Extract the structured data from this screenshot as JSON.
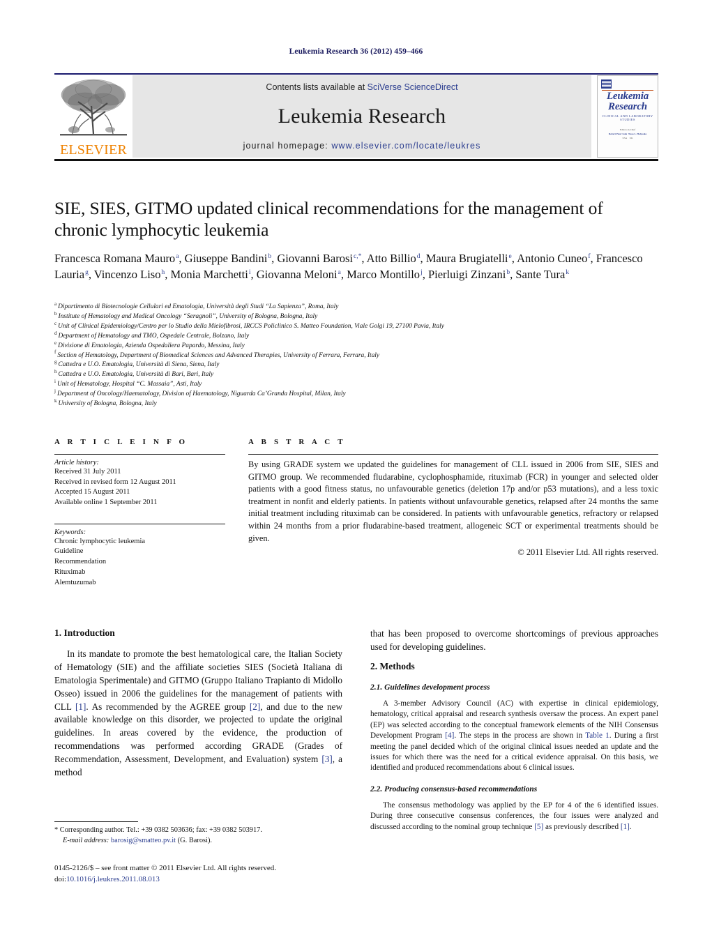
{
  "running_head": "Leukemia Research 36 (2012) 459–466",
  "masthead": {
    "contents_prefix": "Contents lists available at ",
    "contents_link": "SciVerse ScienceDirect",
    "journal_title": "Leukemia Research",
    "homepage_prefix": "journal homepage: ",
    "homepage_url": "www.elsevier.com/locate/leukres",
    "publisher_wordmark": "ELSEVIER",
    "cover": {
      "title_line1": "Leukemia",
      "title_line2": "Research",
      "subtitle": "Clinical and Laboratory Studies",
      "meta_label": "Editors-in-Chief",
      "meta_a": "Robert Peter Gale",
      "meta_b": "Tessa L. Holyoake",
      "meta_a_sub": "USA",
      "meta_b_sub": "UK"
    }
  },
  "article": {
    "title": "SIE, SIES, GITMO updated clinical recommendations for the management of chronic lymphocytic leukemia",
    "authors": [
      {
        "name": "Francesca Romana Mauro",
        "sup": "a",
        "sep": ","
      },
      {
        "name": "Giuseppe Bandini",
        "sup": "b",
        "sep": ","
      },
      {
        "name": "Giovanni Barosi",
        "sup": "c,*",
        "sep": ","
      },
      {
        "name": "Atto Billio",
        "sup": "d",
        "sep": ","
      },
      {
        "name": "Maura Brugiatelli",
        "sup": "e",
        "sep": ","
      },
      {
        "name": "Antonio Cuneo",
        "sup": "f",
        "sep": ","
      },
      {
        "name": "Francesco Lauria",
        "sup": "g",
        "sep": ","
      },
      {
        "name": "Vincenzo Liso",
        "sup": "h",
        "sep": ","
      },
      {
        "name": "Monia Marchetti",
        "sup": "i",
        "sep": ","
      },
      {
        "name": "Giovanna Meloni",
        "sup": "a",
        "sep": ","
      },
      {
        "name": "Marco Montillo",
        "sup": "j",
        "sep": ","
      },
      {
        "name": "Pierluigi Zinzani",
        "sup": "b",
        "sep": ","
      },
      {
        "name": "Sante Tura",
        "sup": "k",
        "sep": ""
      }
    ],
    "affiliations": [
      {
        "mark": "a",
        "text": "Dipartimento di Biotecnologie Cellulari ed Ematologia, Università degli Studi “La Sapienza”, Roma, Italy"
      },
      {
        "mark": "b",
        "text": "Institute of Hematology and Medical Oncology “Seragnoli”, University of Bologna, Bologna, Italy"
      },
      {
        "mark": "c",
        "text": "Unit of Clinical Epidemiology/Centro per lo Studio della Mielofibrosi, IRCCS Policlinico S. Matteo Foundation, Viale Golgi 19, 27100 Pavia, Italy"
      },
      {
        "mark": "d",
        "text": "Department of Hematology and TMO, Ospedale Centrale, Bolzano, Italy"
      },
      {
        "mark": "e",
        "text": "Divisione di Ematologia, Azienda Ospedaliera Papardo, Messina, Italy"
      },
      {
        "mark": "f",
        "text": "Section of Hematology, Department of Biomedical Sciences and Advanced Therapies, University of Ferrara, Ferrara, Italy"
      },
      {
        "mark": "g",
        "text": "Cattedra e U.O. Ematologia, Università di Siena, Siena, Italy"
      },
      {
        "mark": "h",
        "text": "Cattedra e U.O. Ematologia, Università di Bari, Bari, Italy"
      },
      {
        "mark": "i",
        "text": "Unit of Hematology, Hospital “C. Massaia”, Asti, Italy"
      },
      {
        "mark": "j",
        "text": "Department of Oncology/Haematology, Division of Haematology, Niguarda Ca’Granda Hospital, Milan, Italy"
      },
      {
        "mark": "k",
        "text": "University of Bologna, Bologna, Italy"
      }
    ]
  },
  "article_info": {
    "heading": "A R T I C L E   I N F O",
    "history_title": "Article history:",
    "history": [
      "Received 31 July 2011",
      "Received in revised form 12 August 2011",
      "Accepted 15 August 2011",
      "Available online 1 September 2011"
    ],
    "keywords_title": "Keywords:",
    "keywords": [
      "Chronic lymphocytic leukemia",
      "Guideline",
      "Recommendation",
      "Rituximab",
      "Alemtuzumab"
    ]
  },
  "abstract": {
    "heading": "A B S T R A C T",
    "text": "By using GRADE system we updated the guidelines for management of CLL issued in 2006 from SIE, SIES and GITMO group. We recommended fludarabine, cyclophosphamide, rituximab (FCR) in younger and selected older patients with a good fitness status, no unfavourable genetics (deletion 17p and/or p53 mutations), and a less toxic treatment in nonfit and elderly patients. In patients without unfavourable genetics, relapsed after 24 months the same initial treatment including rituximab can be considered. In patients with unfavourable genetics, refractory or relapsed within 24 months from a prior fludarabine-based treatment, allogeneic SCT or experimental treatments should be given.",
    "copyright": "© 2011 Elsevier Ltd. All rights reserved."
  },
  "body": {
    "left": {
      "section1_heading": "1. Introduction",
      "para1_a": "In its mandate to promote the best hematological care, the Italian Society of Hematology (SIE) and the affiliate societies SIES (Società Italiana di Ematologia Sperimentale) and GITMO (Gruppo Italiano Trapianto di Midollo Osseo) issued in 2006 the guidelines for the management of patients with CLL ",
      "ref1": "[1]",
      "para1_b": ". As recommended by the AGREE group ",
      "ref2": "[2]",
      "para1_c": ", and due to the new available knowledge on this disorder, we projected to update the original guidelines. In areas covered by the evidence, the production of recommendations was performed according GRADE (Grades of Recommendation, Assessment, Development, and Evaluation) system ",
      "ref3": "[3]",
      "para1_d": ", a method"
    },
    "right": {
      "para_cont": "that has been proposed to overcome shortcomings of previous approaches used for developing guidelines.",
      "section2_heading": "2. Methods",
      "sub21_heading": "2.1. Guidelines development process",
      "para21_a": "A 3-member Advisory Council (AC) with expertise in clinical epidemiology, hematology, critical appraisal and research synthesis oversaw the process. An expert panel (EP) was selected according to the conceptual framework elements of the NIH Consensus Development Program ",
      "ref4": "[4]",
      "para21_b": ". The steps in the process are shown in ",
      "reft1": "Table 1",
      "para21_c": ". During a first meeting the panel decided which of the original clinical issues needed an update and the issues for which there was the need for a critical evidence appraisal. On this basis, we identified and produced recommendations about 6 clinical issues.",
      "sub22_heading": "2.2. Producing consensus-based recommendations",
      "para22_a": "The consensus methodology was applied by the EP for 4 of the 6 identified issues. During three consecutive consensus conferences, the four issues were analyzed and discussed according to the nominal group technique ",
      "ref5": "[5]",
      "para22_b": " as previously described ",
      "ref1b": "[1]",
      "para22_c": "."
    }
  },
  "footnote": {
    "corresponding": "* Corresponding author. Tel.: +39 0382 503636; fax: +39 0382 503917.",
    "email_label": "E-mail address:",
    "email": "barosig@smatteo.pv.it",
    "email_suffix": "(G. Barosi)."
  },
  "imprint": {
    "line1": "0145-2126/$ – see front matter © 2011 Elsevier Ltd. All rights reserved.",
    "doi_label": "doi:",
    "doi": "10.1016/j.leukres.2011.08.013"
  },
  "colors": {
    "link": "#2b3d8f",
    "elsevier_orange": "#ef8200",
    "rule_navy": "#1a1a6e",
    "banner_bg": "#e6e6e6"
  }
}
